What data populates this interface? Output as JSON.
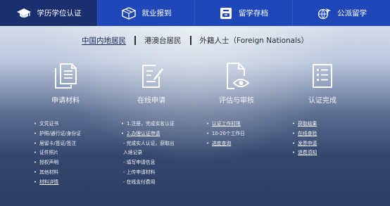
{
  "tabs": [
    {
      "label": "学历学位认证",
      "icon": "graduation-cap-icon",
      "active": true
    },
    {
      "label": "就业报到",
      "icon": "package-box-icon",
      "active": false
    },
    {
      "label": "留学存档",
      "icon": "archive-folder-icon",
      "active": false
    },
    {
      "label": "公派留学",
      "icon": "airplane-globe-icon",
      "active": false
    }
  ],
  "residence": [
    {
      "label": "中国内地居民",
      "active": true
    },
    {
      "label": "港澳台居民",
      "active": false
    },
    {
      "label": "外籍人士（Foreign Nationals）",
      "active": false
    }
  ],
  "steps": [
    {
      "title": "申请材料",
      "icon": "documents-icon"
    },
    {
      "title": "在线申请",
      "icon": "edit-document-icon"
    },
    {
      "title": "评估与审核",
      "icon": "review-eye-icon"
    },
    {
      "title": "认证完成",
      "icon": "checklist-icon"
    }
  ],
  "columns": [
    {
      "lines": [
        {
          "text": "文凭证书",
          "bullet": true,
          "link": false
        },
        {
          "text": "护照/通行证/身份证",
          "bullet": true,
          "link": false
        },
        {
          "text": "居留卡/签证/签注",
          "bullet": true,
          "link": false
        },
        {
          "text": "证件照片",
          "bullet": true,
          "link": false
        },
        {
          "text": "授权声明",
          "bullet": true,
          "link": false
        },
        {
          "text": "其他材料",
          "bullet": true,
          "link": false
        },
        {
          "text": "材料详情",
          "bullet": true,
          "link": true
        }
      ]
    },
    {
      "lines": [
        {
          "text": "1.注册，完成实名认证",
          "bullet": true,
          "link": false
        },
        {
          "text": "2.办理认证申请",
          "bullet": true,
          "link": true
        },
        {
          "text": "- 完成实人认证，获取出",
          "bullet": false,
          "link": false
        },
        {
          "text": "入境记录",
          "bullet": false,
          "link": false
        },
        {
          "text": "- 填写申请信息",
          "bullet": false,
          "link": false
        },
        {
          "text": "- 上传申请材料",
          "bullet": false,
          "link": false
        },
        {
          "text": "- 在线支付费用",
          "bullet": false,
          "link": false
        }
      ]
    },
    {
      "lines": [
        {
          "text": "认证工作时限",
          "bullet": true,
          "link": true
        },
        {
          "text": "10-20个工作日",
          "bullet": true,
          "link": false
        },
        {
          "text": "进度查询",
          "bullet": true,
          "link": true
        }
      ]
    },
    {
      "lines": [
        {
          "text": "获取结果",
          "bullet": true,
          "link": true
        },
        {
          "text": "在线查验",
          "bullet": true,
          "link": true
        },
        {
          "text": "发票申请",
          "bullet": true,
          "link": true
        },
        {
          "text": "退费须知",
          "bullet": true,
          "link": true
        }
      ]
    }
  ],
  "colors": {
    "tab_active": "#1a2f6e",
    "tab_default": "#1f47b8"
  }
}
